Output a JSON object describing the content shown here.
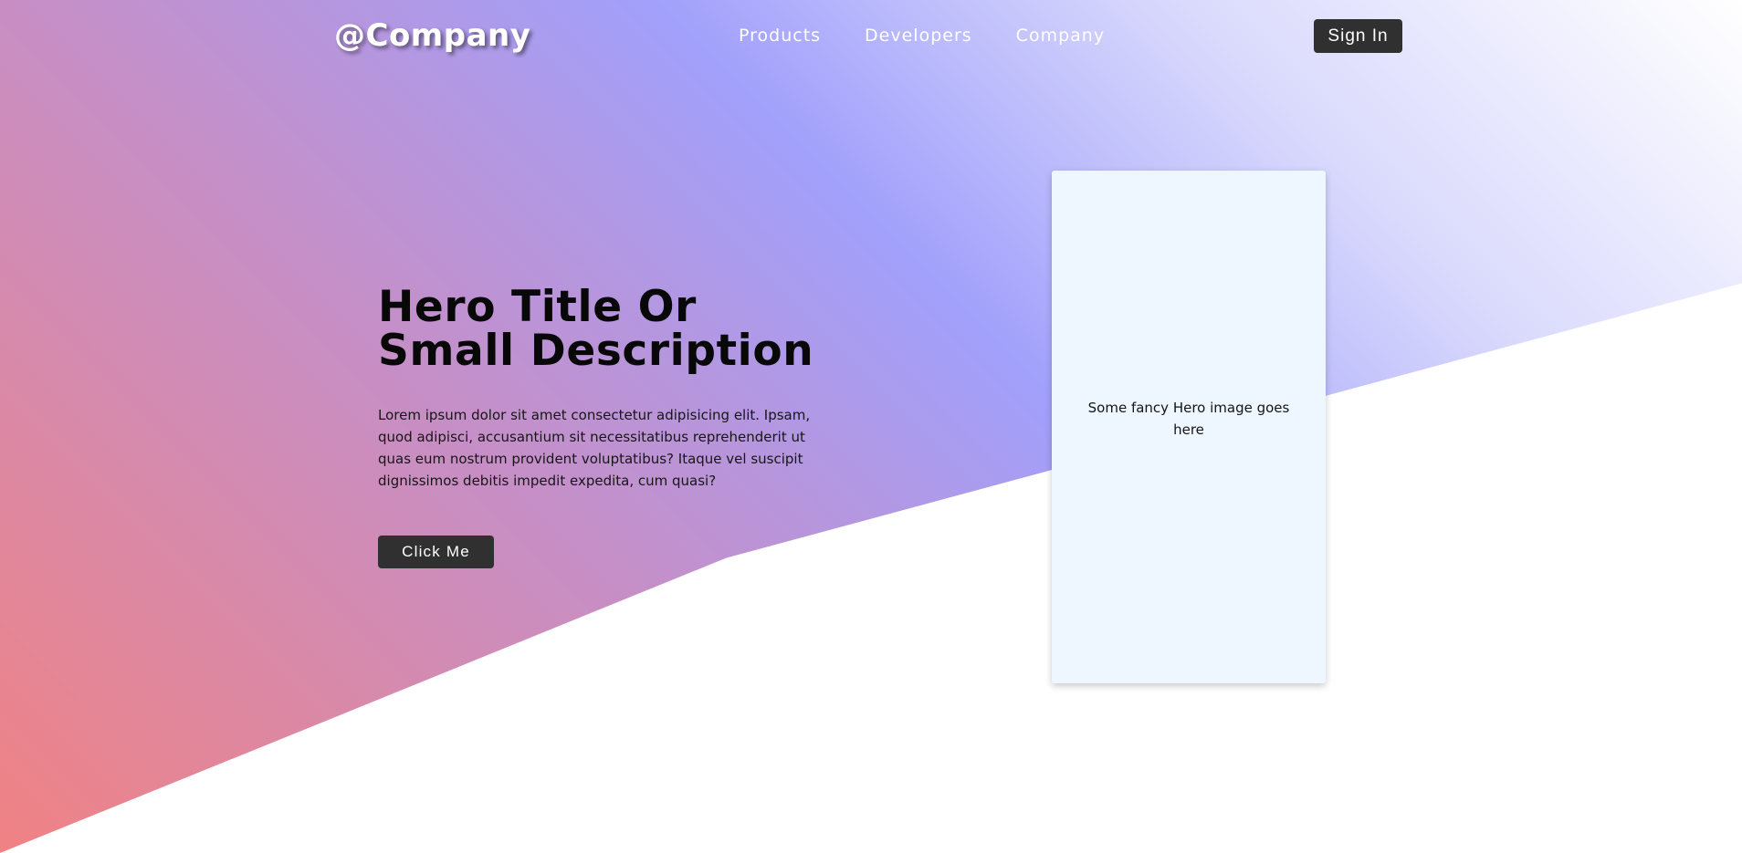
{
  "brand": {
    "name": "@Company"
  },
  "navigation": {
    "links": [
      {
        "label": "Products"
      },
      {
        "label": "Developers"
      },
      {
        "label": "Company"
      }
    ],
    "sign_in_label": "Sign In"
  },
  "hero": {
    "title": "Hero Title Or Small Description",
    "description": "Lorem ipsum dolor sit amet consectetur adipisicing elit. Ipsam, quod adipisci, accusantium sit necessitatibus reprehenderit ut quas eum nostrum provident voluptatibus? Itaque vel suscipit dignissimos debitis impedit expedita, cum quasi?",
    "button_label": "Click Me",
    "image_placeholder": "Some fancy Hero image goes here"
  },
  "colors": {
    "gradient_coral": "#f08283",
    "gradient_violet": "#a1a0fb",
    "button_dark": "#303030",
    "card_background": "#eef7ff",
    "page_background": "#ffffff"
  }
}
